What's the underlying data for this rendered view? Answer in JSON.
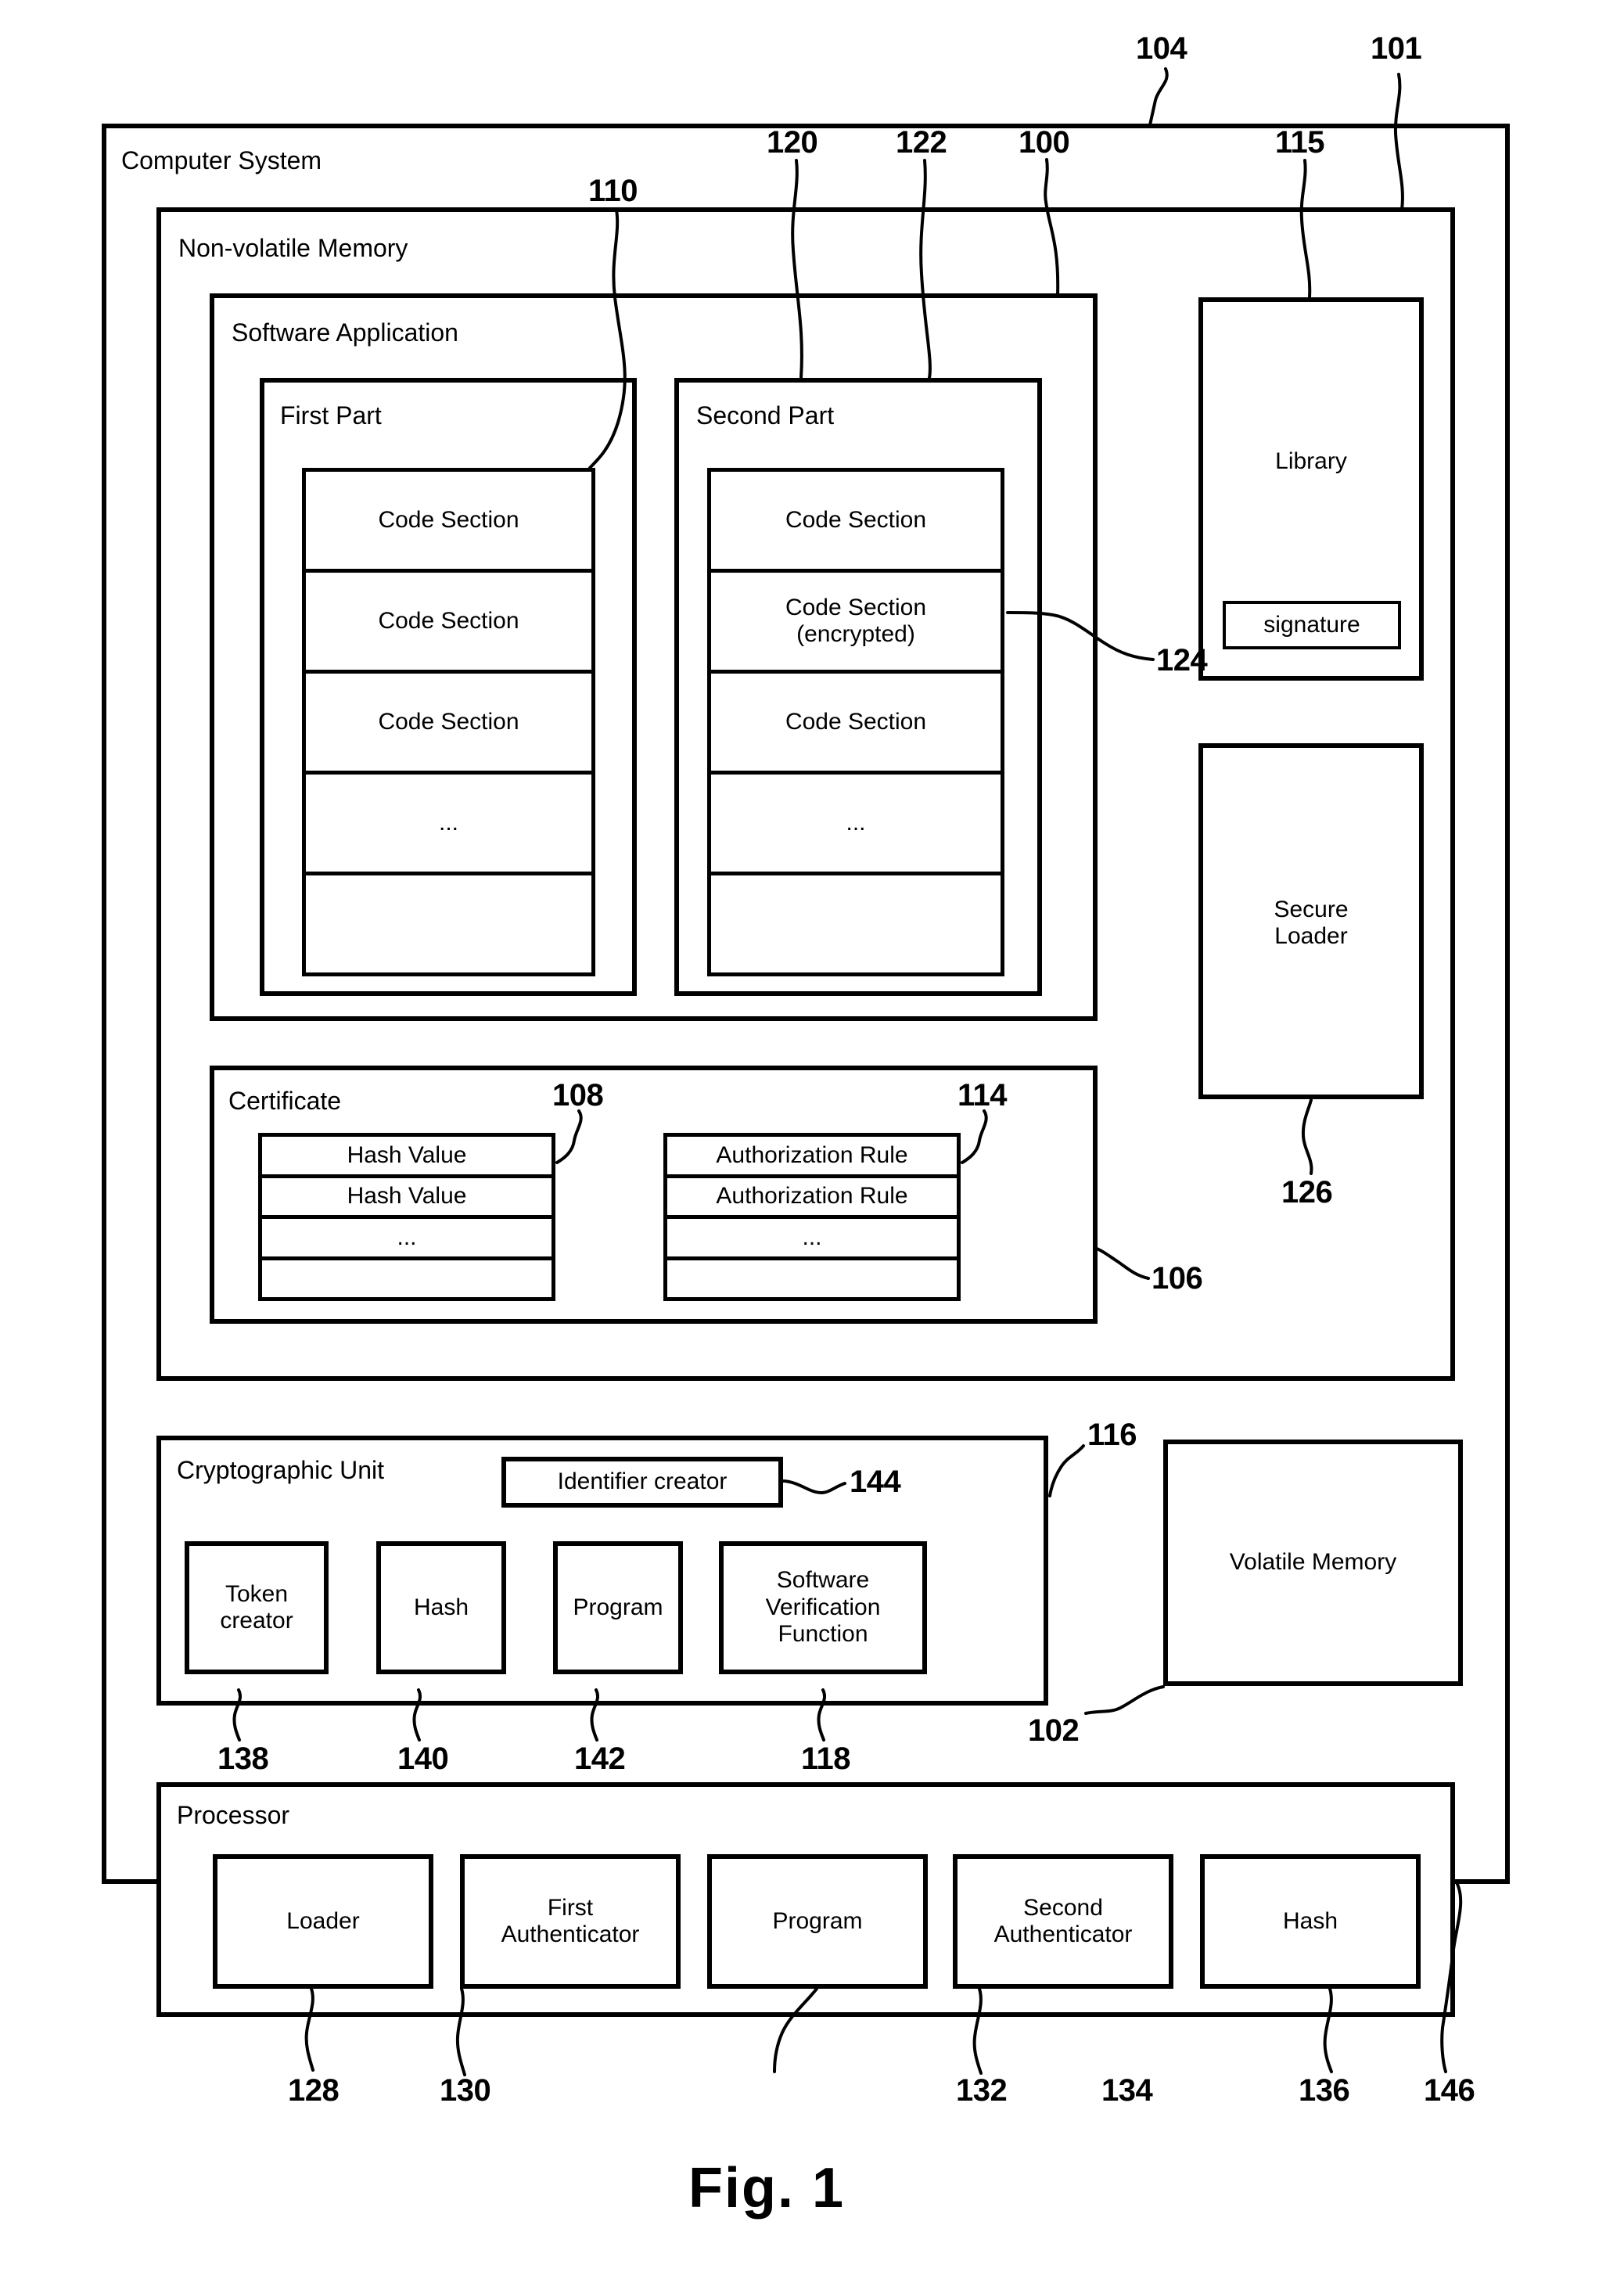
{
  "figure": {
    "caption": "Fig.  1"
  },
  "computer_system": {
    "title": "Computer System",
    "ref": "104",
    "outer_ref": "101"
  },
  "nonvolatile_memory": {
    "title": "Non-volatile Memory",
    "ref": "100"
  },
  "software_application": {
    "title": "Software Application",
    "ref": "120",
    "first_part": {
      "title": "First Part",
      "ref": "110",
      "sections": [
        "Code Section",
        "Code Section",
        "Code Section",
        "...",
        ""
      ]
    },
    "second_part": {
      "title": "Second Part",
      "ref": "122",
      "encrypted_ref": "124",
      "sections": [
        "Code Section",
        "Code Section\n(encrypted)",
        "Code Section",
        "...",
        ""
      ]
    }
  },
  "library": {
    "title": "Library",
    "ref": "115",
    "signature_label": "signature"
  },
  "secure_loader": {
    "title": "Secure\nLoader",
    "ref": "126"
  },
  "certificate": {
    "title": "Certificate",
    "ref": "106",
    "hash_ref": "108",
    "rule_ref": "114",
    "hash_values": [
      "Hash Value",
      "Hash Value",
      "...",
      ""
    ],
    "authorization_rules": [
      "Authorization Rule",
      "Authorization Rule",
      "...",
      ""
    ]
  },
  "cryptographic_unit": {
    "title": "Cryptographic Unit",
    "ref": "116",
    "identifier_creator": {
      "label": "Identifier creator",
      "ref": "144"
    },
    "blocks": [
      {
        "label": "Token\ncreator",
        "ref": "138"
      },
      {
        "label": "Hash",
        "ref": "140"
      },
      {
        "label": "Program",
        "ref": "142"
      },
      {
        "label": "Software\nVerification\nFunction",
        "ref": "118"
      }
    ]
  },
  "volatile_memory": {
    "title": "Volatile Memory",
    "ref": "102"
  },
  "processor": {
    "title": "Processor",
    "ref": "146",
    "blocks": [
      {
        "label": "Loader",
        "ref": "128"
      },
      {
        "label": "First\nAuthenticator",
        "ref": "130"
      },
      {
        "label": "Program",
        "ref": "132"
      },
      {
        "label": "Second\nAuthenticator",
        "ref": "134"
      },
      {
        "label": "Hash",
        "ref": "136"
      }
    ]
  }
}
